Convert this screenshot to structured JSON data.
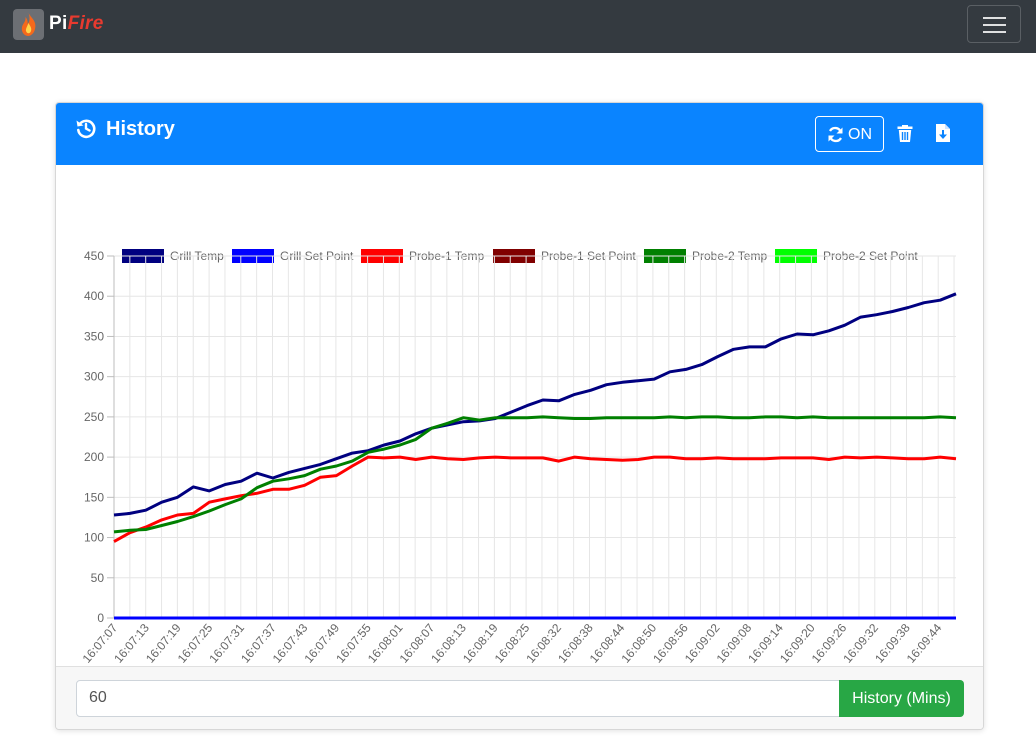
{
  "navbar": {
    "brand_pi": "Pi",
    "brand_fire": "Fire",
    "logo_icon": "flame-icon",
    "menu_icon": "hamburger-menu-icon"
  },
  "card": {
    "title": "History",
    "title_icon": "history-icon",
    "refresh_label": "ON",
    "refresh_icon": "refresh-icon",
    "delete_icon": "trash-icon",
    "export_icon": "download-file-icon"
  },
  "footer": {
    "minutes_value": "60",
    "history_button": "History (Mins)"
  },
  "chart_data": {
    "type": "line",
    "ylim": [
      0,
      450
    ],
    "yticks": [
      0,
      50,
      100,
      150,
      200,
      250,
      300,
      350,
      400,
      450
    ],
    "grid": true,
    "legend_position": "top",
    "xtick_labels": [
      "16:07:07",
      "16:07:13",
      "16:07:19",
      "16:07:25",
      "16:07:31",
      "16:07:37",
      "16:07:43",
      "16:07:49",
      "16:07:55",
      "16:08:01",
      "16:08:07",
      "16:08:13",
      "16:08:19",
      "16:08:25",
      "16:08:32",
      "16:08:38",
      "16:08:44",
      "16:08:50",
      "16:08:56",
      "16:09:02",
      "16:09:08",
      "16:09:14",
      "16:09:20",
      "16:09:26",
      "16:09:32",
      "16:09:38",
      "16:09:44"
    ],
    "series": [
      {
        "name": "Grill Temp",
        "color": "#000080",
        "values": [
          128,
          130,
          134,
          144,
          150,
          163,
          158,
          166,
          170,
          180,
          174,
          181,
          186,
          191,
          198,
          205,
          208,
          215,
          220,
          229,
          236,
          240,
          244,
          245,
          248,
          256,
          264,
          271,
          270,
          278,
          283,
          290,
          293,
          295,
          297,
          306,
          309,
          315,
          325,
          334,
          337,
          337,
          347,
          353,
          352,
          357,
          364,
          374,
          377,
          381,
          386,
          392,
          395,
          403
        ]
      },
      {
        "name": "Grill Set Point",
        "color": "#0000ff",
        "values": [
          0,
          0,
          0,
          0,
          0,
          0,
          0,
          0,
          0,
          0,
          0,
          0,
          0,
          0,
          0,
          0,
          0,
          0,
          0,
          0,
          0,
          0,
          0,
          0,
          0,
          0,
          0,
          0,
          0,
          0,
          0,
          0,
          0,
          0,
          0,
          0,
          0,
          0,
          0,
          0,
          0,
          0,
          0,
          0,
          0,
          0,
          0,
          0,
          0,
          0,
          0,
          0,
          0,
          0
        ]
      },
      {
        "name": "Probe-1 Temp",
        "color": "#ff0000",
        "values": [
          95,
          106,
          113,
          122,
          128,
          130,
          144,
          148,
          152,
          155,
          160,
          160,
          165,
          175,
          177,
          189,
          200,
          199,
          200,
          197,
          200,
          198,
          197,
          199,
          200,
          199,
          199,
          199,
          195,
          200,
          198,
          197,
          196,
          197,
          200,
          200,
          198,
          198,
          199,
          198,
          198,
          198,
          199,
          199,
          199,
          197,
          200,
          199,
          200,
          199,
          198,
          198,
          200,
          198
        ]
      },
      {
        "name": "Probe-1 Set Point",
        "color": "#800000",
        "values": []
      },
      {
        "name": "Probe-2 Temp",
        "color": "#008000",
        "values": [
          107,
          109,
          110,
          115,
          120,
          126,
          133,
          141,
          148,
          162,
          170,
          173,
          177,
          185,
          189,
          195,
          206,
          210,
          215,
          222,
          236,
          242,
          249,
          246,
          249,
          249,
          249,
          250,
          249,
          248,
          248,
          249,
          249,
          249,
          249,
          250,
          249,
          250,
          250,
          249,
          249,
          250,
          250,
          249,
          250,
          249,
          249,
          249,
          249,
          249,
          249,
          249,
          250,
          249
        ]
      },
      {
        "name": "Probe-2 Set Point",
        "color": "#00ff00",
        "values": []
      }
    ]
  }
}
